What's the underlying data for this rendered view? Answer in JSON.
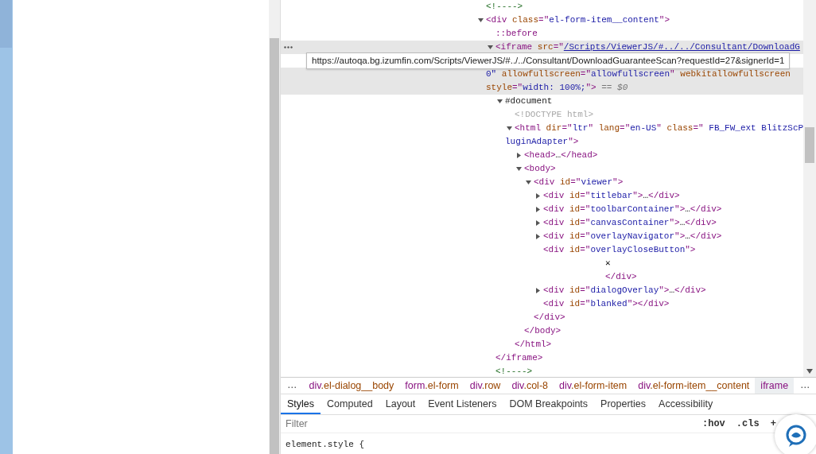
{
  "dom_tree": [
    {
      "lines": [
        [
          {
            "kind": "comment",
            "text": "<!---->"
          }
        ]
      ]
    },
    {
      "expanded": true,
      "selected": false,
      "hovered": false,
      "lines": [
        [
          {
            "kind": "tag",
            "text": "<div "
          },
          {
            "kind": "attr",
            "text": "class"
          },
          {
            "kind": "tag",
            "text": "=\""
          },
          {
            "kind": "val",
            "text": "el-form-item__content"
          },
          {
            "kind": "tag",
            "text": "\">"
          }
        ]
      ],
      "children": [
        {
          "lines": [
            [
              {
                "kind": "tag",
                "text": "::before"
              }
            ]
          ]
        },
        {
          "expanded": true,
          "selected": true,
          "hovered": true,
          "tooltip": "https://autoqa.bg.izumfin.com/Scripts/ViewerJS/#../../Consultant/DownloadGuaranteeScan?requestId=27&signerId=1",
          "lines": [
            [
              {
                "kind": "tag",
                "text": "<iframe "
              },
              {
                "kind": "attr",
                "text": "src"
              },
              {
                "kind": "tag",
                "text": "=\""
              },
              {
                "kind": "link",
                "text": "/Scripts/ViewerJS/#../../Consultant/DownloadG"
              }
            ],
            [
              {
                "kind": "val",
                "text": "0\" "
              },
              {
                "kind": "attr",
                "text": "allowfullscreen"
              },
              {
                "kind": "tag",
                "text": "=\""
              },
              {
                "kind": "val",
                "text": "allowfullscreen"
              },
              {
                "kind": "tag",
                "text": "\" "
              },
              {
                "kind": "attr",
                "text": "webkitallowfullscreen"
              }
            ],
            [
              {
                "kind": "attr",
                "text": "style"
              },
              {
                "kind": "tag",
                "text": "=\""
              },
              {
                "kind": "val",
                "text": "width: 100%;"
              },
              {
                "kind": "tag",
                "text": "\">"
              },
              {
                "kind": "marker",
                "text": " == $0"
              }
            ]
          ],
          "children": [
            {
              "expanded": true,
              "lines": [
                [
                  {
                    "kind": "plain",
                    "text": "#document"
                  }
                ]
              ],
              "children": [
                {
                  "lines": [
                    [
                      {
                        "kind": "doctype",
                        "text": "<!DOCTYPE html>"
                      }
                    ]
                  ]
                },
                {
                  "expanded": true,
                  "selected": false,
                  "hovered": false,
                  "lines": [
                    [
                      {
                        "kind": "tag",
                        "text": "<html "
                      },
                      {
                        "kind": "attr",
                        "text": "dir"
                      },
                      {
                        "kind": "tag",
                        "text": "=\""
                      },
                      {
                        "kind": "val",
                        "text": "ltr"
                      },
                      {
                        "kind": "tag",
                        "text": "\" "
                      },
                      {
                        "kind": "attr",
                        "text": "lang"
                      },
                      {
                        "kind": "tag",
                        "text": "=\""
                      },
                      {
                        "kind": "val",
                        "text": "en-US"
                      },
                      {
                        "kind": "tag",
                        "text": "\" "
                      },
                      {
                        "kind": "attr",
                        "text": "class"
                      },
                      {
                        "kind": "tag",
                        "text": "=\""
                      },
                      {
                        "kind": "val",
                        "text": " FB_FW_ext BlitzScP"
                      }
                    ],
                    [
                      {
                        "kind": "val",
                        "text": "luginAdapter"
                      },
                      {
                        "kind": "tag",
                        "text": "\">"
                      }
                    ]
                  ],
                  "children": [
                    {
                      "expanded": false,
                      "selected": false,
                      "hovered": false,
                      "lines": [
                        [
                          {
                            "kind": "tag",
                            "text": "<head>"
                          },
                          {
                            "kind": "plain",
                            "text": "…"
                          },
                          {
                            "kind": "tag",
                            "text": "</head>"
                          }
                        ]
                      ]
                    },
                    {
                      "expanded": true,
                      "selected": false,
                      "hovered": false,
                      "lines": [
                        [
                          {
                            "kind": "tag",
                            "text": "<body>"
                          }
                        ]
                      ],
                      "children": [
                        {
                          "expanded": true,
                          "selected": false,
                          "hovered": false,
                          "lines": [
                            [
                              {
                                "kind": "tag",
                                "text": "<div "
                              },
                              {
                                "kind": "attr",
                                "text": "id"
                              },
                              {
                                "kind": "tag",
                                "text": "=\""
                              },
                              {
                                "kind": "val",
                                "text": "viewer"
                              },
                              {
                                "kind": "tag",
                                "text": "\">"
                              }
                            ]
                          ],
                          "children": [
                            {
                              "expanded": false,
                              "selected": false,
                              "hovered": false,
                              "lines": [
                                [
                                  {
                                    "kind": "tag",
                                    "text": "<div "
                                  },
                                  {
                                    "kind": "attr",
                                    "text": "id"
                                  },
                                  {
                                    "kind": "tag",
                                    "text": "=\""
                                  },
                                  {
                                    "kind": "val",
                                    "text": "titlebar"
                                  },
                                  {
                                    "kind": "tag",
                                    "text": "\">"
                                  },
                                  {
                                    "kind": "plain",
                                    "text": "…"
                                  },
                                  {
                                    "kind": "tag",
                                    "text": "</div>"
                                  }
                                ]
                              ]
                            },
                            {
                              "expanded": false,
                              "selected": false,
                              "hovered": false,
                              "lines": [
                                [
                                  {
                                    "kind": "tag",
                                    "text": "<div "
                                  },
                                  {
                                    "kind": "attr",
                                    "text": "id"
                                  },
                                  {
                                    "kind": "tag",
                                    "text": "=\""
                                  },
                                  {
                                    "kind": "val",
                                    "text": "toolbarContainer"
                                  },
                                  {
                                    "kind": "tag",
                                    "text": "\">"
                                  },
                                  {
                                    "kind": "plain",
                                    "text": "…"
                                  },
                                  {
                                    "kind": "tag",
                                    "text": "</div>"
                                  }
                                ]
                              ]
                            },
                            {
                              "expanded": false,
                              "selected": false,
                              "hovered": false,
                              "lines": [
                                [
                                  {
                                    "kind": "tag",
                                    "text": "<div "
                                  },
                                  {
                                    "kind": "attr",
                                    "text": "id"
                                  },
                                  {
                                    "kind": "tag",
                                    "text": "=\""
                                  },
                                  {
                                    "kind": "val",
                                    "text": "canvasContainer"
                                  },
                                  {
                                    "kind": "tag",
                                    "text": "\">"
                                  },
                                  {
                                    "kind": "plain",
                                    "text": "…"
                                  },
                                  {
                                    "kind": "tag",
                                    "text": "</div>"
                                  }
                                ]
                              ]
                            },
                            {
                              "expanded": false,
                              "selected": false,
                              "hovered": false,
                              "lines": [
                                [
                                  {
                                    "kind": "tag",
                                    "text": "<div "
                                  },
                                  {
                                    "kind": "attr",
                                    "text": "id"
                                  },
                                  {
                                    "kind": "tag",
                                    "text": "=\""
                                  },
                                  {
                                    "kind": "val",
                                    "text": "overlayNavigator"
                                  },
                                  {
                                    "kind": "tag",
                                    "text": "\">"
                                  },
                                  {
                                    "kind": "plain",
                                    "text": "…"
                                  },
                                  {
                                    "kind": "tag",
                                    "text": "</div>"
                                  }
                                ]
                              ]
                            },
                            {
                              "selected": false,
                              "hovered": false,
                              "lines": [
                                [
                                  {
                                    "kind": "tag",
                                    "text": "<div "
                                  },
                                  {
                                    "kind": "attr",
                                    "text": "id"
                                  },
                                  {
                                    "kind": "tag",
                                    "text": "=\""
                                  },
                                  {
                                    "kind": "val",
                                    "text": "overlayCloseButton"
                                  },
                                  {
                                    "kind": "tag",
                                    "text": "\">"
                                  }
                                ]
                              ],
                              "children": [
                                {
                                  "lines": [
                                    [
                                      {
                                        "kind": "textnode",
                                        "text": "✕"
                                      }
                                    ]
                                  ]
                                }
                              ],
                              "closing": [
                                {
                                  "kind": "tag",
                                  "text": "</div>"
                                }
                              ]
                            },
                            {
                              "expanded": false,
                              "selected": false,
                              "hovered": false,
                              "lines": [
                                [
                                  {
                                    "kind": "tag",
                                    "text": "<div "
                                  },
                                  {
                                    "kind": "attr",
                                    "text": "id"
                                  },
                                  {
                                    "kind": "tag",
                                    "text": "=\""
                                  },
                                  {
                                    "kind": "val",
                                    "text": "dialogOverlay"
                                  },
                                  {
                                    "kind": "tag",
                                    "text": "\">"
                                  },
                                  {
                                    "kind": "plain",
                                    "text": "…"
                                  },
                                  {
                                    "kind": "tag",
                                    "text": "</div>"
                                  }
                                ]
                              ]
                            },
                            {
                              "selected": false,
                              "hovered": false,
                              "lines": [
                                [
                                  {
                                    "kind": "tag",
                                    "text": "<div "
                                  },
                                  {
                                    "kind": "attr",
                                    "text": "id"
                                  },
                                  {
                                    "kind": "tag",
                                    "text": "=\""
                                  },
                                  {
                                    "kind": "val",
                                    "text": "blanked"
                                  },
                                  {
                                    "kind": "tag",
                                    "text": "\"></div>"
                                  }
                                ]
                              ]
                            }
                          ],
                          "closing": [
                            {
                              "kind": "tag",
                              "text": "</div>"
                            }
                          ]
                        }
                      ],
                      "closing": [
                        {
                          "kind": "tag",
                          "text": "</body>"
                        }
                      ]
                    }
                  ],
                  "closing": [
                    {
                      "kind": "tag",
                      "text": "</html>"
                    }
                  ]
                }
              ]
            }
          ],
          "closing": [
            {
              "kind": "tag",
              "text": "</iframe>"
            }
          ]
        },
        {
          "lines": [
            [
              {
                "kind": "comment",
                "text": "<!---->"
              }
            ]
          ]
        }
      ]
    }
  ],
  "breadcrumbs": [
    {
      "tag": "div",
      "cls": ".el-dialog__body",
      "selected": false
    },
    {
      "tag": "form",
      "cls": ".el-form",
      "selected": false
    },
    {
      "tag": "div",
      "cls": ".row",
      "selected": false
    },
    {
      "tag": "div",
      "cls": ".col-8",
      "selected": false
    },
    {
      "tag": "div",
      "cls": ".el-form-item",
      "selected": false
    },
    {
      "tag": "div",
      "cls": ".el-form-item__content",
      "selected": false
    },
    {
      "tag": "iframe",
      "selected": true
    }
  ],
  "breadcrumb_more": [
    "…",
    "…"
  ],
  "tabs": [
    {
      "label": "Styles",
      "selected": true
    },
    {
      "label": "Computed",
      "selected": false
    },
    {
      "label": "Layout",
      "selected": false
    },
    {
      "label": "Event Listeners",
      "selected": false
    },
    {
      "label": "DOM Breakpoints",
      "selected": false
    },
    {
      "label": "Properties",
      "selected": false
    },
    {
      "label": "Accessibility",
      "selected": false
    }
  ],
  "filter": {
    "placeholder": "Filter"
  },
  "filter_buttons": [
    ":hov",
    ".cls",
    "+"
  ],
  "styles_first_line": "element.style {"
}
